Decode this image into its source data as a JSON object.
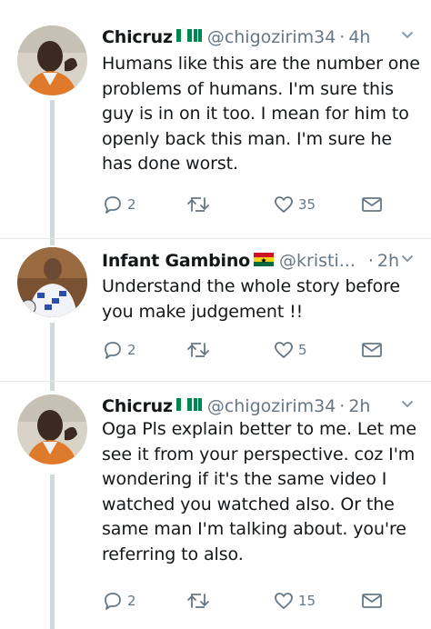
{
  "tweets": [
    {
      "name": "Chicruz",
      "flag": "nigeria-flag",
      "handle": "@chigozirim34",
      "separator": "·",
      "time": "4h",
      "text_lines": [
        "Humans like this are the number one",
        "problems of humans.  I'm sure this",
        "guy is in on it too. I mean for him to",
        "openly back this man. I'm sure he",
        "has done worst."
      ],
      "replies": "2",
      "retweets": "",
      "likes": "35"
    },
    {
      "name": "Infant Gambino",
      "flag": "ghana-flag",
      "handle": "@kristi...",
      "separator": "·",
      "time": "2h",
      "text_lines": [
        "Understand the whole story before",
        "you make judgement !!"
      ],
      "replies": "2",
      "retweets": "",
      "likes": "5"
    },
    {
      "name": "Chicruz",
      "flag": "nigeria-flag",
      "handle": "@chigozirim34",
      "separator": "·",
      "time": "2h",
      "text_lines": [
        "Oga Pls explain better to me. Let me",
        "see it from your perspective. coz I'm",
        "wondering if it's the same video I",
        "watched you watched also. Or the",
        "same man I'm talking about. you're",
        "referring to also."
      ],
      "replies": "2",
      "retweets": "",
      "likes": "15"
    }
  ],
  "colors": {
    "text": "#14171a",
    "secondary": "#657786",
    "thread_line": "#cfd9de",
    "nigeria_green": "#008751",
    "ghana_red": "#ce1126",
    "ghana_gold": "#fcd116",
    "ghana_green": "#006b3f"
  },
  "icons": [
    "reply-icon",
    "retweet-icon",
    "like-icon",
    "message-icon",
    "chevron-down-icon"
  ]
}
